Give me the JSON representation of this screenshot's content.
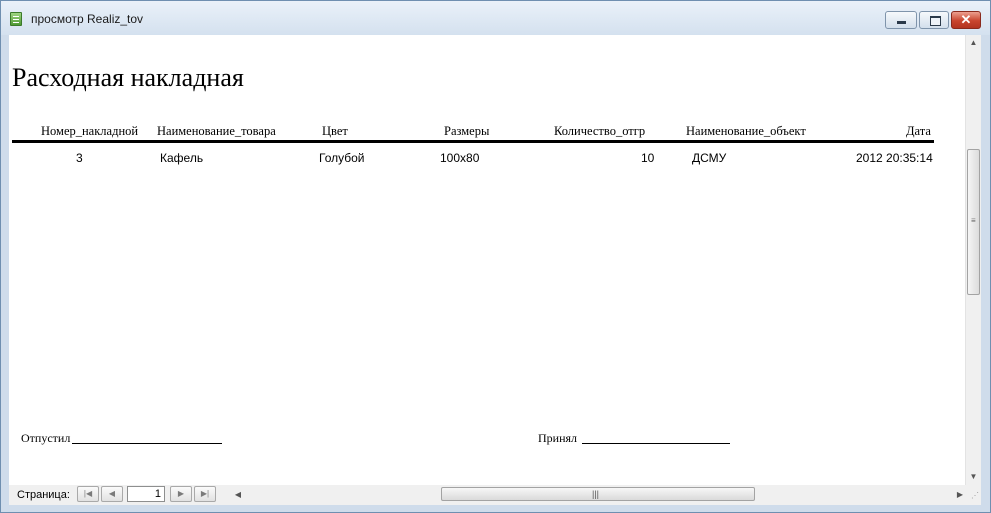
{
  "window": {
    "title": "просмотр Realiz_tov",
    "controls": {
      "minimize": "",
      "maximize": "",
      "close": "✕"
    }
  },
  "report": {
    "title": "Расходная накладная",
    "columns": [
      "Номер_накладной",
      "Наименование_товара",
      "Цвет",
      "Размеры",
      "Количество_отгр",
      "Наименование_объект",
      "Дата"
    ],
    "rows": [
      [
        "3",
        "Кафель",
        "Голубой",
        "100x80",
        "10",
        "ДСМУ",
        "2012 20:35:14"
      ]
    ],
    "signatures": {
      "released_label": "Отпустил",
      "received_label": "Принял"
    }
  },
  "navigation": {
    "page_label": "Страница:",
    "current_page": "1",
    "icons": [
      "first-page-icon",
      "prev-page-icon",
      "next-page-icon",
      "last-page-icon"
    ]
  },
  "colors": {
    "title_bar_top": "#eaf1f9",
    "close_button": "#c9452e",
    "window_border": "#6f8fb0"
  }
}
